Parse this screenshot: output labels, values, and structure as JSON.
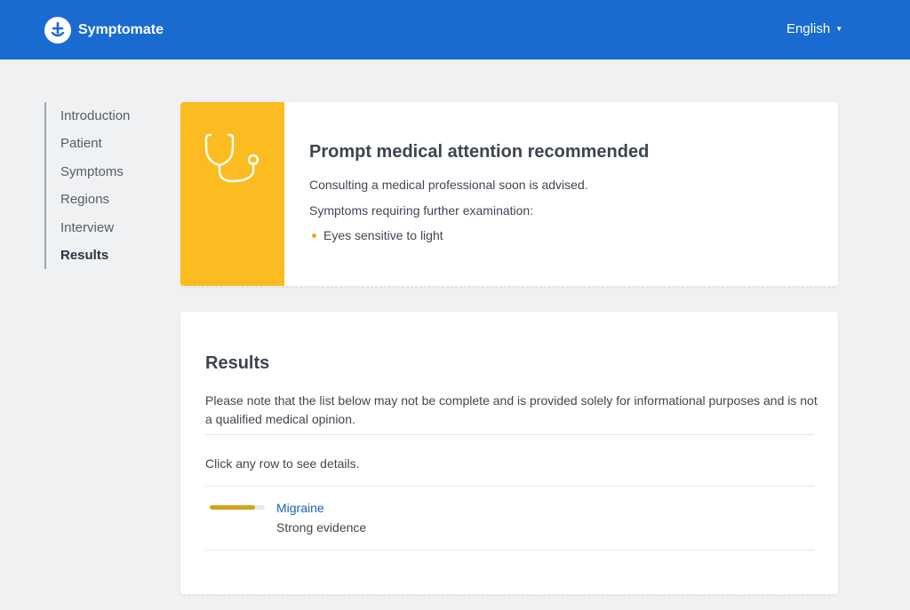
{
  "header": {
    "brand": "Symptomate",
    "language": "English",
    "icons": {
      "logo": "symptomate-logo-icon",
      "caret": "caret-down-icon"
    },
    "colors": {
      "bar": "#1a6bd0"
    }
  },
  "sidebar": {
    "items": [
      {
        "label": "Introduction",
        "active": false
      },
      {
        "label": "Patient",
        "active": false
      },
      {
        "label": "Symptoms",
        "active": false
      },
      {
        "label": "Regions",
        "active": false
      },
      {
        "label": "Interview",
        "active": false
      },
      {
        "label": "Results",
        "active": true
      }
    ]
  },
  "triage": {
    "icon": "stethoscope-icon",
    "accent_color": "#fbbc21",
    "title": "Prompt medical attention recommended",
    "advice": "Consulting a medical professional soon is advised.",
    "symptoms_heading": "Symptoms requiring further examination:",
    "symptoms": [
      "Eyes sensitive to light"
    ]
  },
  "results": {
    "title": "Results",
    "note": "Please note that the list below may not be complete and is provided solely for informational purposes and is not a qualified medical opinion.",
    "hint": "Click any row to see details.",
    "conditions": [
      {
        "name": "Migraine",
        "evidence": "Strong evidence",
        "evidence_level": 0.82,
        "bar_color": "#d4a21d"
      }
    ]
  }
}
